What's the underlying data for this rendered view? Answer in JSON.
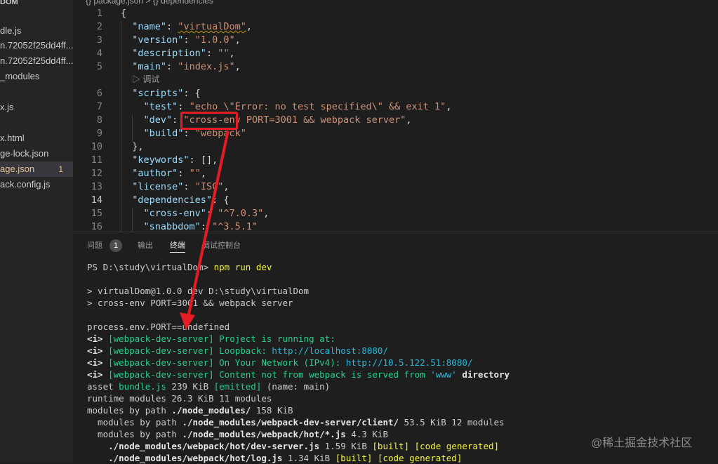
{
  "sidebar": {
    "items": [
      {
        "label": "\u0000",
        "partial": "DOM"
      },
      {
        "label": "dle.js"
      },
      {
        "label": "n.72052f25dd4ff..."
      },
      {
        "label": "n.72052f25dd4ff..."
      },
      {
        "label": "_modules"
      },
      {
        "label": "x.js"
      },
      {
        "label": "x.html"
      },
      {
        "label": "ge-lock.json"
      },
      {
        "label": "age.json",
        "badge": "1"
      },
      {
        "label": "ack.config.js"
      }
    ]
  },
  "editor": {
    "breadcrumb": "{} package.json > {} dependencies",
    "codelens": "▷ 调试",
    "lines": [
      {
        "num": "1"
      },
      {
        "num": "2"
      },
      {
        "num": "3"
      },
      {
        "num": "4"
      },
      {
        "num": "5"
      },
      {
        "num": "6"
      },
      {
        "num": "7"
      },
      {
        "num": "8"
      },
      {
        "num": "9"
      },
      {
        "num": "10"
      },
      {
        "num": "11"
      },
      {
        "num": "12"
      },
      {
        "num": "13"
      },
      {
        "num": "14"
      },
      {
        "num": "15"
      },
      {
        "num": "16"
      }
    ],
    "tokens": {
      "l1_brace": "{",
      "name_key": "\"name\"",
      "name_val": "\"virtualDom\"",
      "version_key": "\"version\"",
      "version_val": "\"1.0.0\"",
      "description_key": "\"description\"",
      "description_val": "\"\"",
      "main_key": "\"main\"",
      "main_val": "\"index.js\"",
      "scripts_key": "\"scripts\"",
      "test_key": "\"test\"",
      "test_val": "\"echo \\\"Error: no test specified\\\" && exit 1\"",
      "dev_key": "\"dev\"",
      "dev_val": "\"cross-env PORT=3001 && webpack server\"",
      "build_key": "\"build\"",
      "build_val": "\"webpack\"",
      "close_obj": "},",
      "keywords_key": "\"keywords\"",
      "keywords_val": "[],",
      "author_key": "\"author\"",
      "author_val": "\"\"",
      "license_key": "\"license\"",
      "license_val": "\"ISC\"",
      "dependencies_key": "\"dependencies\"",
      "crossenv_key": "\"cross-env\"",
      "crossenv_val": "\"^7.0.3\"",
      "snabbdom_key": "\"snabbdom\"",
      "snabbdom_val": "\"^3.5.1\""
    }
  },
  "panel": {
    "tabs": [
      {
        "label": "问题"
      },
      {
        "label": "输出"
      },
      {
        "label": "终端"
      },
      {
        "label": "调试控制台"
      }
    ],
    "problems_count": "1",
    "terminal": {
      "prompt": "PS D:\\study\\virtualDom> ",
      "cmd": "npm run dev",
      "l3": "> virtualDom@1.0.0 dev D:\\study\\virtualDom",
      "l4": "> cross-env PORT=3001 && webpack server",
      "l6": "process.env.PORT==undefined",
      "i_tag": "<i> ",
      "wds": "[webpack-dev-server]",
      "running": " Project is running at:",
      "loopback": " Loopback: ",
      "loopback_url": "http://localhost:8080/",
      "network": " On Your Network (IPv4): ",
      "network_url": "http://10.5.122.51:8080/",
      "content": " Content not from webpack is served from ",
      "www": "'www'",
      "directory": " directory",
      "asset_pre": "asset ",
      "bundle": "bundle.js",
      "asset_size": " 239 KiB ",
      "emitted": "[emitted]",
      "asset_name": " (name: main)",
      "runtime": "runtime modules 26.3 KiB 11 modules",
      "mbp": "modules by path ",
      "nm_path": "./node_modules/",
      "nm_size": " 158 KiB",
      "mbp2": "  modules by path ",
      "client_path": "./node_modules/webpack-dev-server/client/",
      "client_size": " 53.5 KiB 12 modules",
      "hot_path": "./node_modules/webpack/hot/*.js",
      "hot_size": " 4.3 KiB",
      "dev_server_path": "    ./node_modules/webpack/hot/dev-server.js",
      "dev_server_size": " 1.59 KiB ",
      "built": "[built]",
      "code_generated": "[code generated]",
      "log_path": "    ./node_modules/webpack/hot/log.js",
      "log_size": " 1.34 KiB "
    }
  },
  "watermark": "@稀土掘金技术社区"
}
